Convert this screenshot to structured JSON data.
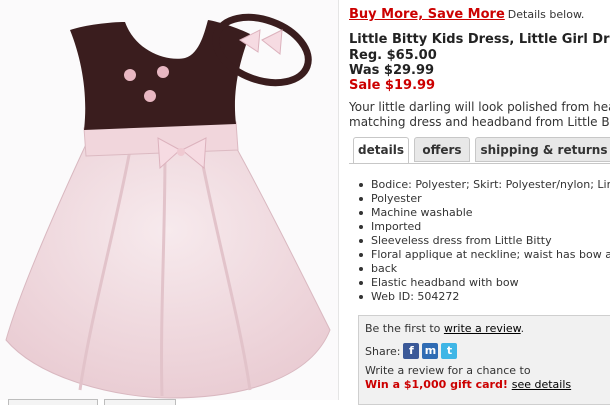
{
  "promo": {
    "link": "Buy More, Save More",
    "note": "Details below."
  },
  "product": {
    "title": "Little Bitty Kids Dress, Little Girl Dress and Headband",
    "reg_price": "Reg. $65.00",
    "was_price": "Was $29.99",
    "sale_price": "Sale $19.99",
    "description_lines": [
      "Your little darling will look polished from head to toe in this",
      "matching dress and headband from Little Bitty."
    ]
  },
  "tabs": [
    {
      "label": "details",
      "active": true
    },
    {
      "label": "offers",
      "active": false
    },
    {
      "label": "shipping & returns",
      "active": false
    }
  ],
  "details": [
    "Bodice: Polyester; Skirt: Polyester/nylon; Lining:",
    "Polyester",
    "Machine washable",
    "Imported",
    "Sleeveless dress from Little Bitty",
    "Floral applique at neckline; waist has bow at side;",
    "back",
    "Elastic headband with bow",
    "Web ID: 504272"
  ],
  "review": {
    "prefix": "Be the first to",
    "link": "write a review",
    "suffix": ".",
    "share_label": "Share:",
    "share_icons": [
      "facebook-icon",
      "myspace-icon",
      "twitter-icon"
    ],
    "chance_text": "Write a review for a chance to",
    "win_text": "Win a $1,000 gift card!",
    "see_details": "see details"
  },
  "colors": {
    "sale_red": "#cc0000",
    "bodice": "#3a1d1e",
    "skirt": "#f3e1e5"
  }
}
